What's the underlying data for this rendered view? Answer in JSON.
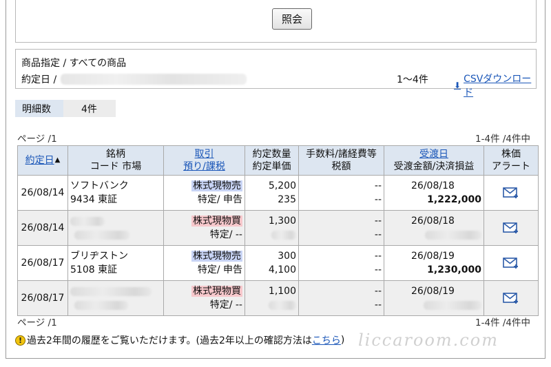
{
  "query": {
    "button_label": "照会"
  },
  "conditions": {
    "product_line": "商品指定 / すべての商品",
    "date_label": "約定日 /",
    "range": "1～4件",
    "csv_label": "CSVダウンロード"
  },
  "count": {
    "label": "明細数",
    "value": "4件"
  },
  "pagination": {
    "page": "ページ /1",
    "summary": "1-4件 /4件中"
  },
  "table": {
    "headers": {
      "date": "約定日",
      "issue_line1": "銘柄",
      "issue_line2": "コード 市場",
      "trade_line1": "取引",
      "trade_line2": "預り/課税",
      "qty_line1": "約定数量",
      "qty_line2": "約定単価",
      "fee_line1": "手数料/諸経費等",
      "fee_line2": "税額",
      "settle_line1": "受渡日",
      "settle_line2": "受渡金額/決済損益",
      "alert_line1": "株価",
      "alert_line2": "アラート"
    },
    "rows": [
      {
        "date": "26/08/14",
        "name": "ソフトバンク",
        "code_market": "9434  東証",
        "trade": "株式現物売",
        "trade_type": "sell",
        "account": "特定/ 申告",
        "qty": "5,200",
        "price": "235",
        "fee": "--",
        "tax": "--",
        "settle_date": "26/08/18",
        "amount": "1,222,000"
      },
      {
        "date": "26/08/14",
        "name": "",
        "code_market": "",
        "trade": "株式現物買",
        "trade_type": "buy",
        "account": "特定/ --",
        "qty": "1,300",
        "price": "",
        "fee": "--",
        "tax": "--",
        "settle_date": "26/08/18",
        "amount": ""
      },
      {
        "date": "26/08/17",
        "name": "ブリヂストン",
        "code_market": "5108  東証",
        "trade": "株式現物売",
        "trade_type": "sell",
        "account": "特定/ 申告",
        "qty": "300",
        "price": "4,100",
        "fee": "--",
        "tax": "--",
        "settle_date": "26/08/19",
        "amount": "1,230,000"
      },
      {
        "date": "26/08/17",
        "name": "",
        "code_market": "",
        "trade": "株式現物買",
        "trade_type": "buy",
        "account": "特定/ --",
        "qty": "1,100",
        "price": "",
        "fee": "--",
        "tax": "--",
        "settle_date": "26/08/19",
        "amount": ""
      }
    ]
  },
  "footer": {
    "note_before": "過去2年間の履歴をご覧いただけます。(過去2年以上の確認方法は",
    "note_link": "こちら",
    "note_after": ")"
  },
  "watermark": "liccaroom.com",
  "colors": {
    "header_bg": "#dde6f1",
    "link": "#1a56b8",
    "sell_tag": "#c8d4f5",
    "buy_tag": "#f7c8cc",
    "shaded_row": "#efefef"
  }
}
